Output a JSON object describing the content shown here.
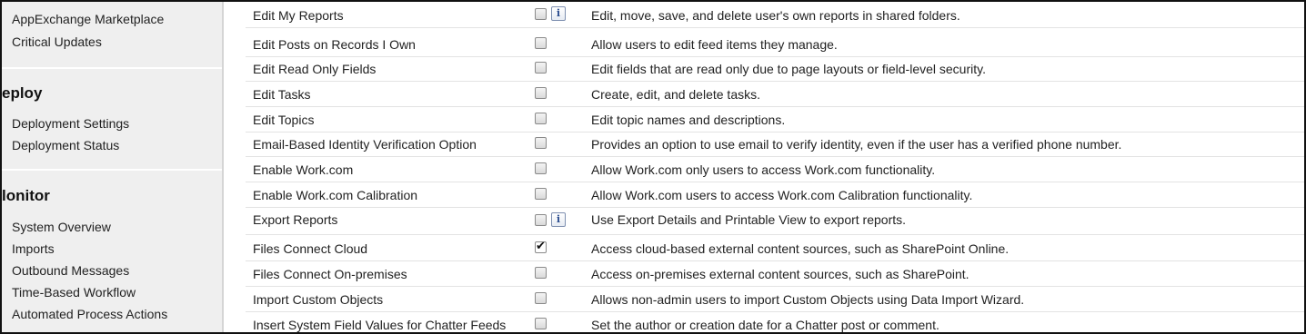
{
  "sidebar": {
    "top_items": [
      "AppExchange Marketplace",
      "Critical Updates"
    ],
    "deploy": {
      "heading": "eploy",
      "items": [
        "Deployment Settings",
        "Deployment Status"
      ]
    },
    "monitor": {
      "heading": "lonitor",
      "items": [
        "System Overview",
        "Imports",
        "Outbound Messages",
        "Time-Based Workflow",
        "Automated Process Actions"
      ]
    }
  },
  "permissions": [
    {
      "name": "Edit My Reports",
      "checked": false,
      "info": true,
      "description": "Edit, move, save, and delete user's own reports in shared folders."
    },
    {
      "name": "Edit Posts on Records I Own",
      "checked": false,
      "info": false,
      "description": "Allow users to edit feed items they manage."
    },
    {
      "name": "Edit Read Only Fields",
      "checked": false,
      "info": false,
      "description": "Edit fields that are read only due to page layouts or field-level security."
    },
    {
      "name": "Edit Tasks",
      "checked": false,
      "info": false,
      "description": "Create, edit, and delete tasks."
    },
    {
      "name": "Edit Topics",
      "checked": false,
      "info": false,
      "description": "Edit topic names and descriptions."
    },
    {
      "name": "Email-Based Identity Verification Option",
      "checked": false,
      "info": false,
      "description": "Provides an option to use email to verify identity, even if the user has a verified phone number."
    },
    {
      "name": "Enable Work.com",
      "checked": false,
      "info": false,
      "description": "Allow Work.com only users to access Work.com functionality."
    },
    {
      "name": "Enable Work.com Calibration",
      "checked": false,
      "info": false,
      "description": "Allow Work.com users to access Work.com Calibration functionality."
    },
    {
      "name": "Export Reports",
      "checked": false,
      "info": true,
      "description": "Use Export Details and Printable View to export reports."
    },
    {
      "name": "Files Connect Cloud",
      "checked": true,
      "info": false,
      "description": "Access cloud-based external content sources, such as SharePoint Online."
    },
    {
      "name": "Files Connect On-premises",
      "checked": false,
      "info": false,
      "description": "Access on-premises external content sources, such as SharePoint."
    },
    {
      "name": "Import Custom Objects",
      "checked": false,
      "info": false,
      "description": "Allows non-admin users to import Custom Objects using Data Import Wizard."
    },
    {
      "name": "Insert System Field Values for Chatter Feeds",
      "checked": false,
      "info": false,
      "description": "Set the author or creation date for a Chatter post or comment."
    }
  ],
  "labels": {
    "info_glyph": "i",
    "check_glyph": "✔"
  }
}
